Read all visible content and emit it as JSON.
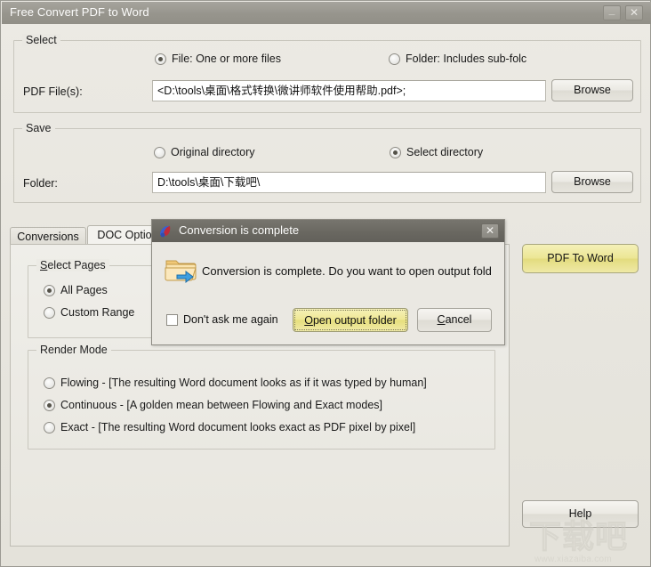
{
  "window": {
    "title": "Free Convert PDF to Word",
    "minimize_label": "_",
    "close_label": "✕"
  },
  "select_group": {
    "legend": "Select",
    "radio_file_label": "File:  One or more files",
    "radio_folder_label": "Folder: Includes sub-folc",
    "pdf_files_label": "PDF File(s):",
    "pdf_files_value": "<D:\\tools\\桌面\\格式转换\\微讲师软件使用帮助.pdf>;",
    "browse_label": "Browse"
  },
  "save_group": {
    "legend": "Save",
    "radio_original_label": "Original directory",
    "radio_select_label": "Select directory",
    "folder_label": "Folder:",
    "folder_value": "D:\\tools\\桌面\\下载吧\\",
    "browse_label": "Browse"
  },
  "tabs": [
    {
      "label": "Conversions",
      "active": false
    },
    {
      "label": "DOC Optio",
      "active": true
    }
  ],
  "pages_group": {
    "legend_underlined": "S",
    "legend_rest": "elect Pages",
    "radio_all_label": "All Pages",
    "radio_custom_label": "Custom Range"
  },
  "render_group": {
    "legend": "Render Mode",
    "options": [
      "Flowing - [The resulting Word document looks as if it was typed by human]",
      "Continuous - [A golden mean between Flowing and Exact modes]",
      "Exact - [The resulting Word document looks exact as PDF pixel by pixel]"
    ]
  },
  "actions": {
    "convert_label": "PDF To Word",
    "help_label": "Help"
  },
  "dialog": {
    "title": "Conversion is complete",
    "close_label": "✕",
    "message": "Conversion is complete. Do you want to open output fold",
    "checkbox_label": "Don't ask me again",
    "primary_underline": "O",
    "primary_rest": "pen output folder",
    "cancel_underline": "C",
    "cancel_rest": "ancel"
  },
  "watermark": {
    "text_cn": "下载吧",
    "url": "www.xiazaiba.com"
  },
  "colors": {
    "window_bg": "#eae8e2",
    "titlebar": "#97958d",
    "dialog_titlebar": "#6a6861",
    "accent_yellow": "#ece694",
    "border": "#c9c7be"
  }
}
